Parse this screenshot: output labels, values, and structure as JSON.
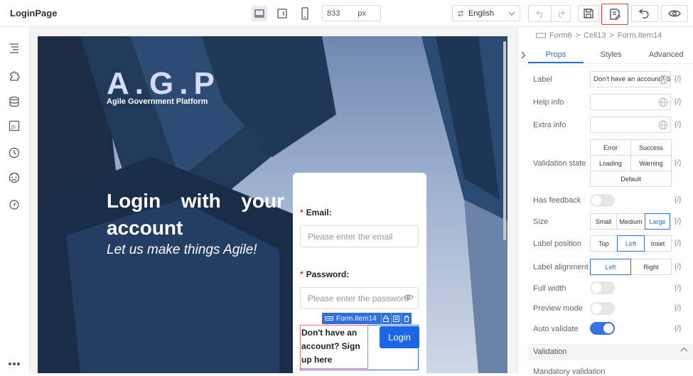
{
  "app": {
    "title": "LoginPage"
  },
  "toolbar": {
    "width_value": "833",
    "width_unit": "px",
    "language": "English"
  },
  "page": {
    "logo": "A.G.P",
    "logo_subtitle": "Agile Government Platform",
    "headline": "Login with your account",
    "tagline": "Let us make things Agile!",
    "form": {
      "email_label": "Email:",
      "email_placeholder": "Please enter the email",
      "password_label": "Password:",
      "password_placeholder": "Please enter the password",
      "selected_item": "Form.Item14",
      "signup_text": "Don't have an account? Sign up here",
      "login_button": "Login"
    }
  },
  "panel": {
    "breadcrumb": [
      "Form6",
      "Cell13",
      "Form.Item14"
    ],
    "tabs": [
      "Props",
      "Styles",
      "Advanced"
    ],
    "active_tab": "Props",
    "var_symbol": "{/}",
    "label": {
      "name": "Label",
      "value": "Don't have an account? Sign up here"
    },
    "help_info": {
      "name": "Help info",
      "value": ""
    },
    "extra_info": {
      "name": "Extra info",
      "value": ""
    },
    "validation_state": {
      "name": "Validation state",
      "options": [
        "Error",
        "Success",
        "Loading",
        "Warning",
        "Default"
      ]
    },
    "has_feedback": {
      "name": "Has feedback",
      "on": false
    },
    "size": {
      "name": "Size",
      "options": [
        "Small",
        "Medium",
        "Large"
      ],
      "selected": "Large"
    },
    "label_position": {
      "name": "Label position",
      "options": [
        "Top",
        "Left",
        "Inset"
      ],
      "selected": "Left"
    },
    "label_alignment": {
      "name": "Label alignment",
      "options": [
        "Left",
        "Right"
      ],
      "selected": "Left"
    },
    "full_width": {
      "name": "Full width",
      "on": false
    },
    "preview_mode": {
      "name": "Preview mode",
      "on": false
    },
    "auto_validate": {
      "name": "Auto validate",
      "on": true
    },
    "validation_section": "Validation",
    "mandatory_validation": "Mandatory validation"
  },
  "colors": {
    "accent": "#2f6fde",
    "required": "#e53935",
    "highlight_border": "#e53935"
  }
}
